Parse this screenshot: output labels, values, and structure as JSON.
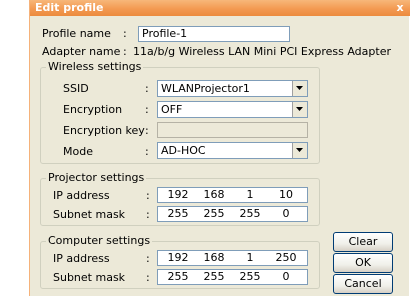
{
  "dialog": {
    "title": "Edit profile",
    "close_glyph": "x"
  },
  "profile": {
    "name_label": "Profile name",
    "name_value": "Profile-1",
    "adapter_label": "Adapter name",
    "adapter_value": "11a/b/g Wireless LAN Mini PCI Express Adapter"
  },
  "wireless": {
    "title": "Wireless settings",
    "ssid_label": "SSID",
    "ssid_value": "WLANProjector1",
    "encryption_label": "Encryption",
    "encryption_value": "OFF",
    "key_label": "Encryption key",
    "key_value": "",
    "mode_label": "Mode",
    "mode_value": "AD-HOC"
  },
  "projector": {
    "title": "Projector settings",
    "ip_label": "IP address",
    "ip": [
      "192",
      "168",
      "1",
      "10"
    ],
    "mask_label": "Subnet mask",
    "mask": [
      "255",
      "255",
      "255",
      "0"
    ]
  },
  "computer": {
    "title": "Computer settings",
    "ip_label": "IP address",
    "ip": [
      "192",
      "168",
      "1",
      "250"
    ],
    "mask_label": "Subnet mask",
    "mask": [
      "255",
      "255",
      "255",
      "0"
    ]
  },
  "buttons": {
    "clear": "Clear",
    "ok": "OK",
    "cancel": "Cancel"
  },
  "separator": ":",
  "colors": {
    "titlebar": "#f39a52",
    "window_bg": "#ece9d8",
    "field_border": "#7f9db9"
  }
}
